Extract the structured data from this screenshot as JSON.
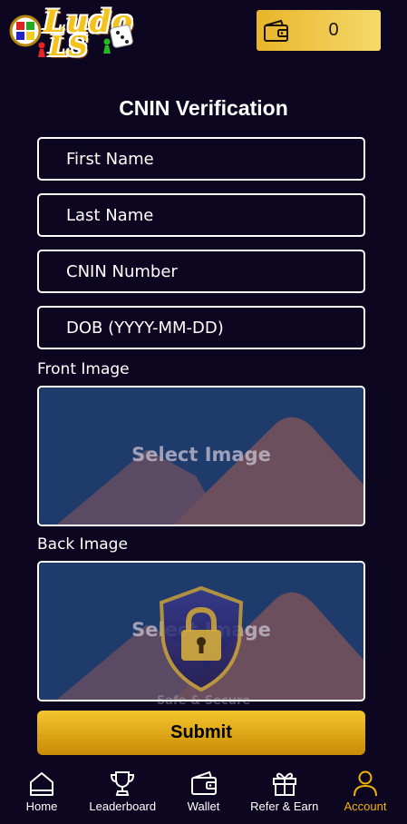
{
  "header": {
    "logo_text_1": "Ludo",
    "logo_text_2": "LS",
    "wallet_icon": "wallet-icon",
    "balance": "0"
  },
  "form": {
    "title": "CNIN Verification",
    "first_name_placeholder": "First Name",
    "last_name_placeholder": "Last Name",
    "cnin_placeholder": "CNIN Number",
    "dob_placeholder": "DOB (YYYY-MM-DD)",
    "front_label": "Front Image",
    "front_select_text": "Select Image",
    "back_label": "Back Image",
    "back_select_text": "Select Image",
    "safe_text": "Safe & Secure",
    "submit_label": "Submit"
  },
  "nav": {
    "items": [
      {
        "label": "Home",
        "icon": "home-icon"
      },
      {
        "label": "Leaderboard",
        "icon": "trophy-icon"
      },
      {
        "label": "Wallet",
        "icon": "wallet-icon"
      },
      {
        "label": "Refer & Earn",
        "icon": "gift-icon"
      },
      {
        "label": "Account",
        "icon": "user-icon"
      }
    ],
    "active_color": "#f4b400"
  },
  "colors": {
    "background": "#0c0620",
    "accent": "#f3c52c"
  }
}
